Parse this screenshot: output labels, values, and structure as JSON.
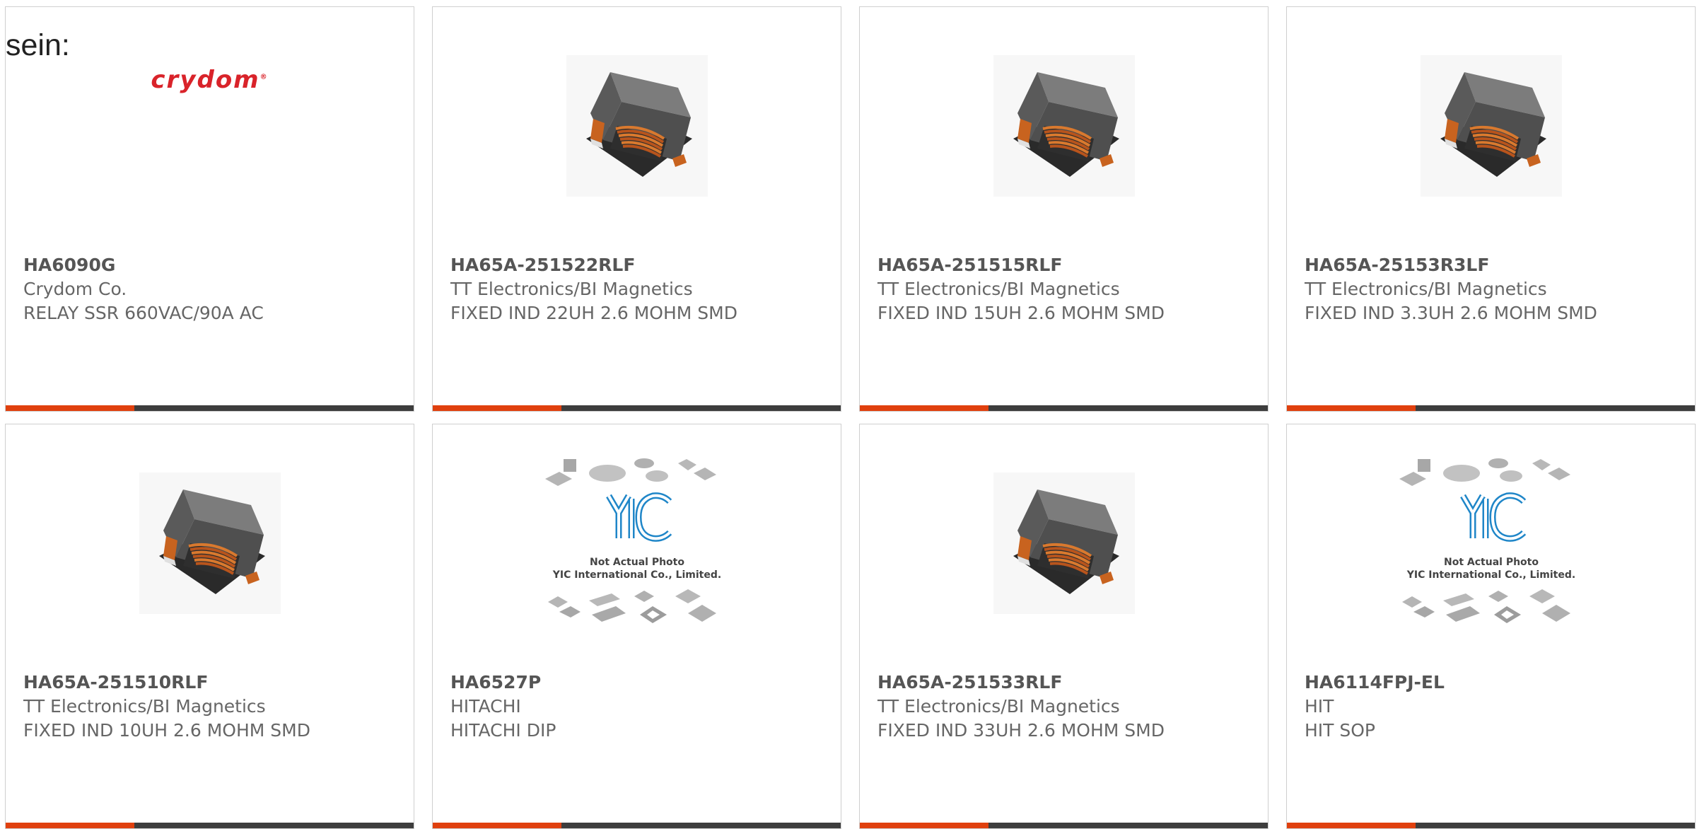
{
  "header": {
    "text": "sein:"
  },
  "products": [
    {
      "part_number": "HA6090G",
      "manufacturer": "Crydom Co.",
      "description": "RELAY SSR 660VAC/90A AC",
      "image": "brand-logo",
      "logo_text": "crydom"
    },
    {
      "part_number": "HA65A-251522RLF",
      "manufacturer": "TT Electronics/BI Magnetics",
      "description": "FIXED IND 22UH 2.6 MOHM SMD",
      "image": "inductor-photo"
    },
    {
      "part_number": "HA65A-251515RLF",
      "manufacturer": "TT Electronics/BI Magnetics",
      "description": "FIXED IND 15UH 2.6 MOHM SMD",
      "image": "inductor-photo"
    },
    {
      "part_number": "HA65A-25153R3LF",
      "manufacturer": "TT Electronics/BI Magnetics",
      "description": "FIXED IND 3.3UH 2.6 MOHM SMD",
      "image": "inductor-photo"
    },
    {
      "part_number": "HA65A-251510RLF",
      "manufacturer": "TT Electronics/BI Magnetics",
      "description": "FIXED IND 10UH 2.6 MOHM SMD",
      "image": "inductor-photo"
    },
    {
      "part_number": "HA6527P",
      "manufacturer": "HITACHI",
      "description": "HITACHI DIP",
      "image": "placeholder-photo",
      "placeholder_line1": "Not Actual Photo",
      "placeholder_line2": "YIC International Co., Limited."
    },
    {
      "part_number": "HA65A-251533RLF",
      "manufacturer": "TT Electronics/BI Magnetics",
      "description": "FIXED IND 33UH 2.6 MOHM SMD",
      "image": "inductor-photo"
    },
    {
      "part_number": "HA6114FPJ-EL",
      "manufacturer": "HIT",
      "description": "HIT SOP",
      "image": "placeholder-photo",
      "placeholder_line1": "Not Actual Photo",
      "placeholder_line2": "YIC International Co., Limited."
    }
  ],
  "colors": {
    "accent": "#e0400e",
    "bar": "#3d3d3d",
    "text": "#666666",
    "logo": "#d9232a",
    "yic_blue": "#1f86c8"
  }
}
